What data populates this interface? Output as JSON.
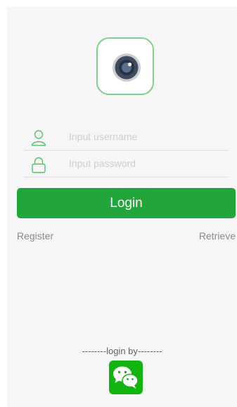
{
  "app": {
    "logo_icon": "camera-lens-icon"
  },
  "form": {
    "username": {
      "icon": "user-icon",
      "placeholder": "Input username",
      "value": ""
    },
    "password": {
      "icon": "lock-icon",
      "placeholder": "Input password",
      "value": ""
    },
    "login_label": "Login"
  },
  "links": {
    "register": "Register",
    "retrieve": "Retrieve"
  },
  "social": {
    "label": "--------login by--------",
    "wechat_icon": "wechat-icon"
  },
  "colors": {
    "accent": "#22a53b",
    "logo_border": "#7fd08a",
    "wechat": "#13b312",
    "background": "#f6f6f6"
  }
}
